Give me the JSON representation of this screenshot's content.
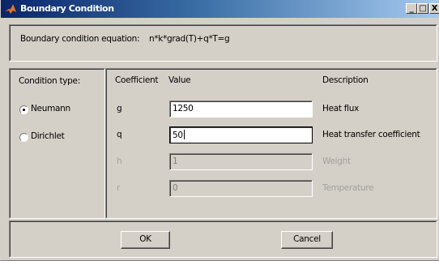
{
  "window": {
    "title": "Boundary Condition",
    "controls": {
      "minimize": "_",
      "maximize": "□",
      "close": "X"
    }
  },
  "equation": {
    "label": "Boundary condition equation:",
    "formula": "n*k*grad(T)+q*T=g"
  },
  "condition_type": {
    "label": "Condition type:",
    "options": [
      {
        "label": "Neumann",
        "selected": true
      },
      {
        "label": "Dirichlet",
        "selected": false
      }
    ]
  },
  "table": {
    "headers": {
      "coefficient": "Coefficient",
      "value": "Value",
      "description": "Description"
    },
    "rows": [
      {
        "coefficient": "g",
        "value": "1250",
        "description": "Heat flux",
        "enabled": true
      },
      {
        "coefficient": "q",
        "value": "50",
        "description": "Heat transfer coefficient",
        "enabled": true
      },
      {
        "coefficient": "h",
        "value": "1",
        "description": "Weight",
        "enabled": false
      },
      {
        "coefficient": "r",
        "value": "0",
        "description": "Temperature",
        "enabled": false
      }
    ]
  },
  "buttons": {
    "ok": "OK",
    "cancel": "Cancel"
  },
  "icons": {
    "app": "matlab-icon"
  },
  "colors": {
    "title_bar": "#0a246a",
    "face": "#d4d0c8",
    "disabled_text": "#a0a0a0"
  }
}
